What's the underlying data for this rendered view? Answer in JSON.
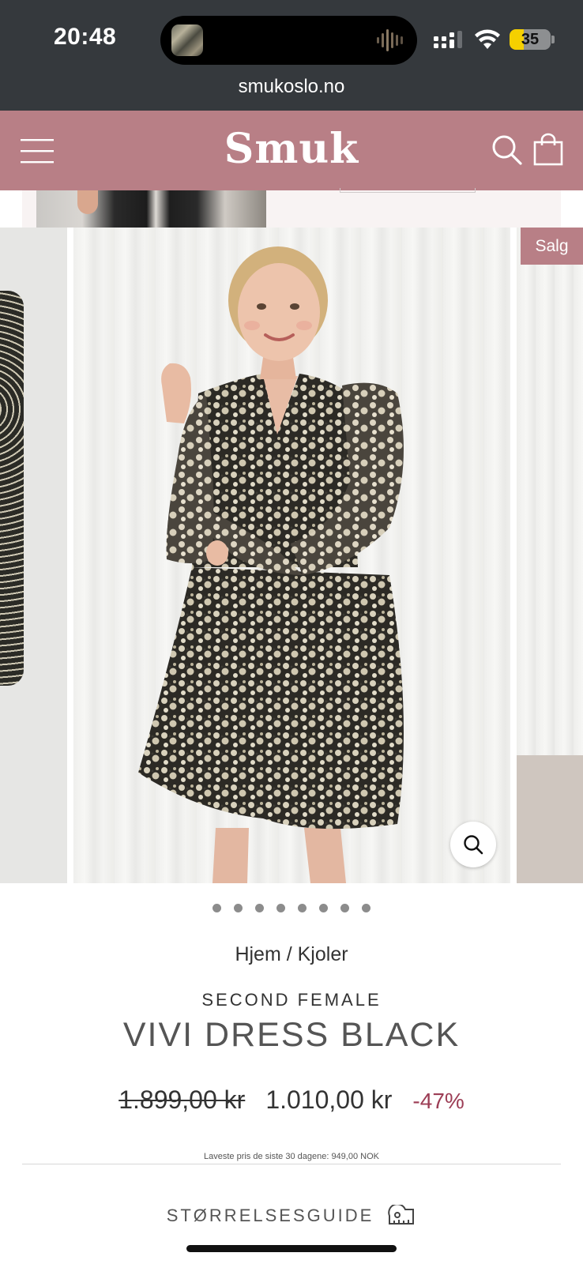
{
  "status_bar": {
    "time": "20:48",
    "battery": "35",
    "url": "smukoslo.no"
  },
  "header": {
    "logo": "Smuk",
    "menu_icon": "hamburger-menu-icon",
    "search_icon": "search-icon",
    "cart_icon": "shopping-bag-icon",
    "background": "#b87f86"
  },
  "gallery": {
    "sale_badge": "Salg",
    "slide_count": 8,
    "zoom_icon": "magnifier-icon"
  },
  "product": {
    "breadcrumb": "Hjem / Kjoler",
    "brand": "SECOND FEMALE",
    "title": "VIVI DRESS BLACK",
    "old_price": "1.899,00 kr",
    "price": "1.010,00 kr",
    "discount": "-47%",
    "lowest_price_note": "Laveste pris de siste 30 dagene: 949,00 NOK",
    "size_guide": "STØRRELSESGUIDE",
    "size_guide_icon": "measuring-tape-icon"
  },
  "colors": {
    "accent": "#b87f86",
    "discount": "#9c3d55",
    "status_bar": "#35393d"
  }
}
